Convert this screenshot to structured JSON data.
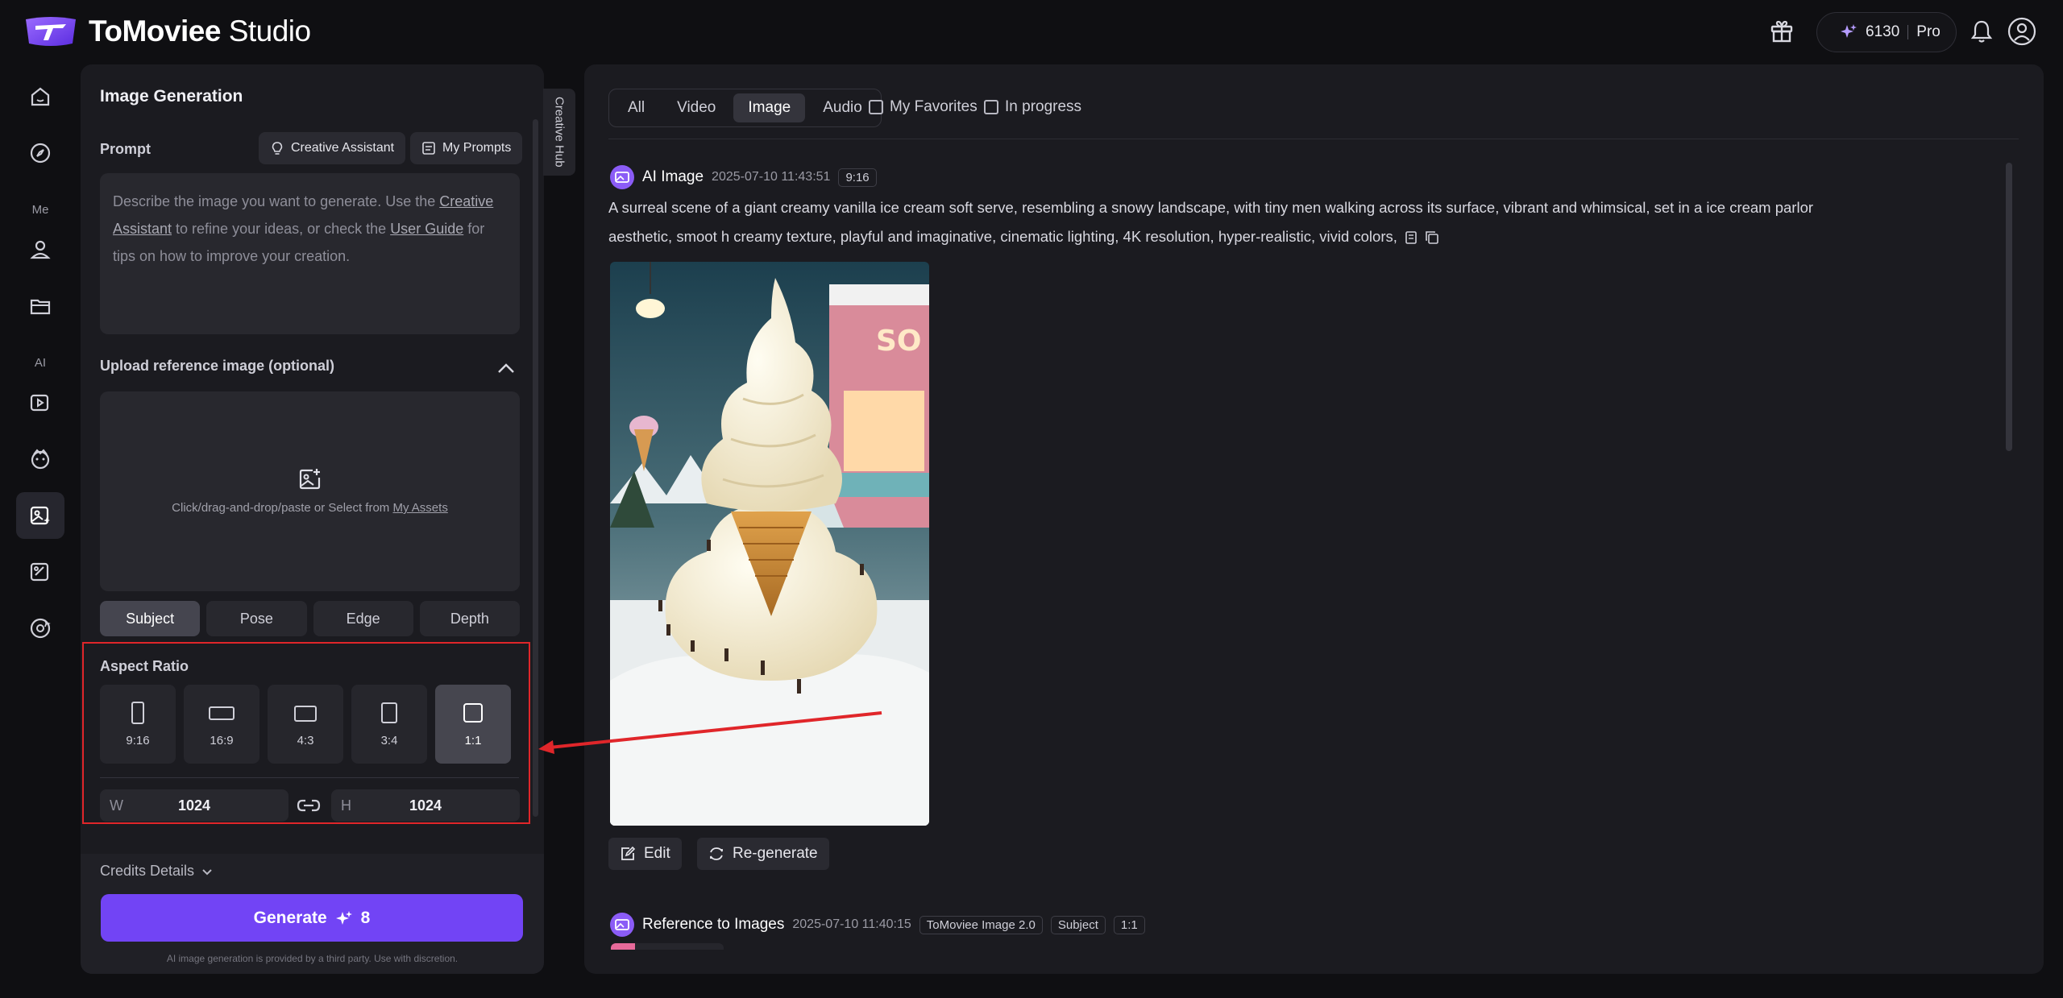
{
  "app": {
    "name_bold": "ToMoviee",
    "name_light": "Studio",
    "credits": "6130",
    "plan": "Pro"
  },
  "nav": {
    "section_me": "Me",
    "section_ai": "AI"
  },
  "panel": {
    "title": "Image Generation",
    "side_tab": "Creative Hub",
    "prompt": {
      "label": "Prompt",
      "creative_assistant": "Creative Assistant",
      "my_prompts": "My Prompts",
      "placeholder_1": "Describe the image you want to generate. Use the ",
      "placeholder_link1": "Creative Assistant",
      "placeholder_2": " to refine your ideas, or check the ",
      "placeholder_link2": "User Guide",
      "placeholder_3": " for tips on how to improve your creation."
    },
    "upload": {
      "label": "Upload reference image (optional)",
      "hint": "Click/drag-and-drop/paste or Select from ",
      "hint_link": "My Assets",
      "ref_types": [
        "Subject",
        "Pose",
        "Edge",
        "Depth"
      ],
      "active_ref": "Subject"
    },
    "aspect": {
      "label": "Aspect Ratio",
      "options": [
        "9:16",
        "16:9",
        "4:3",
        "3:4",
        "1:1"
      ],
      "selected": "1:1",
      "width_label": "W",
      "width": "1024",
      "height_label": "H",
      "height": "1024"
    },
    "credits_details": "Credits Details",
    "generate_label": "Generate",
    "generate_cost": "8",
    "disclaimer": "AI image generation is provided by a third party. Use with discretion."
  },
  "content": {
    "filters": [
      "All",
      "Video",
      "Image",
      "Audio"
    ],
    "active_filter": "Image",
    "checkboxes": [
      "My Favorites",
      "In progress"
    ],
    "items": [
      {
        "title": "AI Image",
        "time": "2025-07-10 11:43:51",
        "tags": [
          "9:16"
        ],
        "prompt": "A surreal scene of a giant creamy vanilla ice cream soft serve, resembling a snowy landscape, with tiny men walking across its surface, vibrant and whimsical, set in a ice cream parlor aesthetic, smoot h creamy texture, playful and imaginative, cinematic lighting, 4K resolution, hyper-realistic, vivid colors,",
        "actions": [
          "Edit",
          "Re-generate"
        ]
      },
      {
        "title": "Reference to Images",
        "time": "2025-07-10 11:40:15",
        "tags": [
          "ToMoviee Image 2.0",
          "Subject",
          "1:1"
        ]
      }
    ]
  },
  "colors": {
    "accent": "#7244f5",
    "highlight": "#e0262a",
    "badge": "#8b5cf6"
  }
}
